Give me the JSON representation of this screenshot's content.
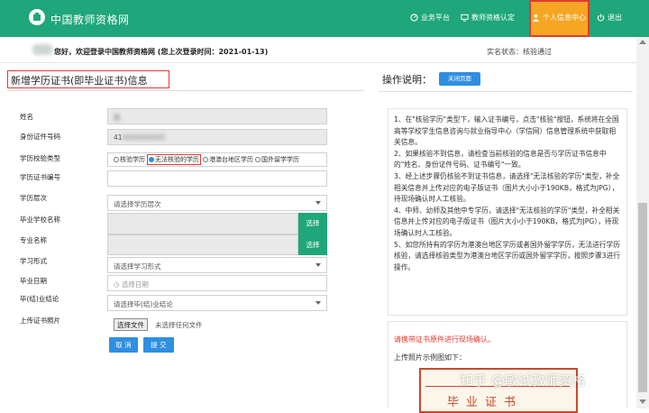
{
  "header": {
    "brand": "中国教师资格网",
    "nav": [
      {
        "label": "业务平台",
        "icon": "dashboard-icon"
      },
      {
        "label": "教师资格认定",
        "icon": "monitor-icon"
      },
      {
        "label": "个人信息中心",
        "icon": "user-icon"
      },
      {
        "label": "退出",
        "icon": "power-icon"
      }
    ],
    "active_color": "#f5a623",
    "brand_color": "#1fa67a"
  },
  "welcome": {
    "greeting": "您好，欢迎登录中国教师资格网 (您上次登录时间：2021-01-13)",
    "status": "实名状态：核验通过"
  },
  "form": {
    "title": "新增学历证书(即毕业证书)信息",
    "fields": {
      "name": {
        "label": "姓名",
        "value": "蔡"
      },
      "id_number": {
        "label": "身份证件号码",
        "value": "41"
      },
      "verify_type": {
        "label": "学历校验类型",
        "options": [
          "核验学历",
          "无法核验的学历",
          "港澳台地区学历",
          "国外留学学历"
        ],
        "selected": "无法核验的学历"
      },
      "cert_number": {
        "label": "学历证书编号",
        "value": ""
      },
      "level": {
        "label": "学历层次",
        "value": "请选择学历层次"
      },
      "school": {
        "label": "毕业学校名称",
        "value": ""
      },
      "major": {
        "label": "专业名称",
        "value": ""
      },
      "study_form": {
        "label": "学习形式",
        "value": "请选择学习形式"
      },
      "grad_date": {
        "label": "毕业日期",
        "placeholder": "选择日期"
      },
      "conclusion": {
        "label": "毕(结)业结论",
        "value": "请选择毕(结)业结论"
      },
      "photo": {
        "label": "上传证书照片",
        "file_button": "选择文件",
        "file_status": "未选择任何文件"
      }
    },
    "select_button": "选择",
    "cancel_button": "取 消",
    "submit_button": "提 交"
  },
  "instructions": {
    "title": "操作说明：",
    "close_button": "关闭页面",
    "items": [
      "1、在\"核验学历\"类型下，输入证书编号，点击\"核验\"按钮，系统将在全国高等学校学生信息咨询与就业指导中心（学信网）信息管理系统中获取相关信息。",
      "2、如果核验不到信息，请检查当前核验的信息是否与学历证书信息中的\"姓名、身份证件号码、证书编号\"一致。",
      "3、经上述步骤仍核验不到证书信息，请选择\"无法核验的学历\"类型，补全相关信息并上传对应的电子版证书（图片大小小于190KB，格式为JPG），待现场确认时人工核验。",
      "4、中师、幼师及其他中专学历，请选择\"无法核验的学历\"类型，补全相关信息并上传对应的电子版证书（图片大小小于190KB，格式为JPG），待现场确认时人工核验。",
      "5、如您所持有的学历为港澳台地区学历或者国外留学学历，无法进行学历核验，请选择核验类型为港澳台地区学历或国外留学学历，按照步骤3进行操作。"
    ],
    "warning": "请携带证书原件进行现场确认。",
    "sample_label": "上传照片示例图如下：",
    "sample_cert_title": "毕业证书"
  },
  "watermark": "知乎 @敏试教师资格"
}
